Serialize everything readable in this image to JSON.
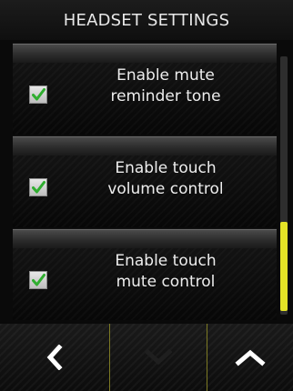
{
  "title_bar": {
    "title": "HEADSET SETTINGS"
  },
  "settings": [
    {
      "line1": "Enable mute",
      "line2": "reminder tone",
      "checked": true
    },
    {
      "line1": "Enable touch",
      "line2": "volume control",
      "checked": true
    },
    {
      "line1": "Enable touch",
      "line2": "mute control",
      "checked": true
    }
  ],
  "scrollbar": {
    "position": 1.0,
    "thumb_color": "#e4e326"
  },
  "nav": {
    "back_icon": "chevron-left-icon",
    "down_icon": "chevron-down-icon",
    "up_icon": "chevron-up-icon",
    "down_disabled": true
  },
  "colors": {
    "background": "#0a0a0a",
    "text": "#ededed",
    "checkmark": "#2fae2f",
    "accent": "#e4e326"
  }
}
